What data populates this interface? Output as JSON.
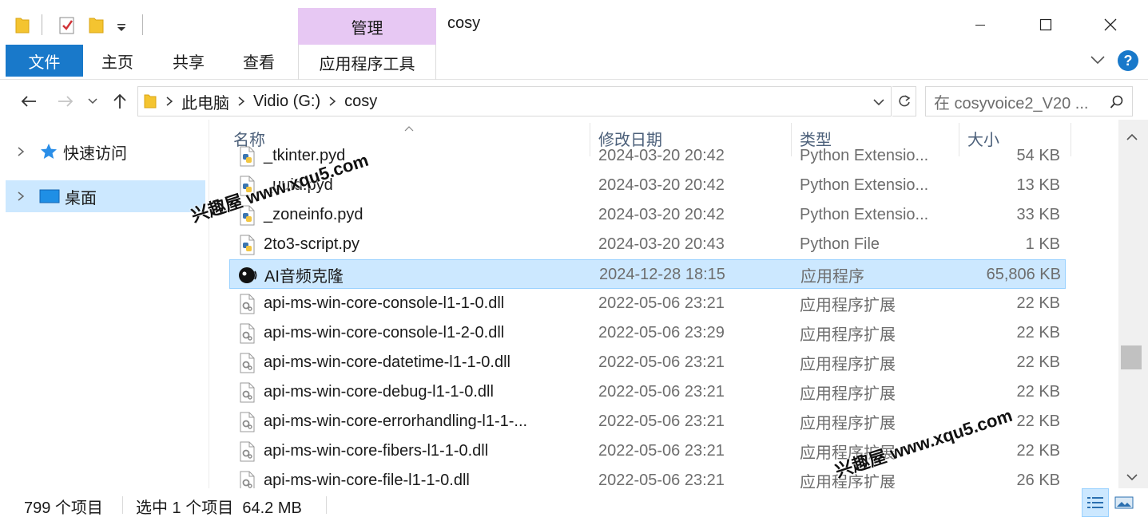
{
  "window": {
    "title": "cosy",
    "manage_tab": "管理",
    "min_icon": "minimize-icon",
    "max_icon": "maximize-icon",
    "close_icon": "close-icon"
  },
  "ribbon": {
    "file": "文件",
    "home": "主页",
    "share": "共享",
    "view": "查看",
    "app_tools": "应用程序工具",
    "help": "?"
  },
  "address": {
    "crumbs": [
      "此电脑",
      "Vidio (G:)",
      "cosy"
    ],
    "search_placeholder": "在 cosyvoice2_V20 ..."
  },
  "nav": {
    "items": [
      {
        "label": "快速访问",
        "icon": "star-icon",
        "selected": false
      },
      {
        "label": "桌面",
        "icon": "desktop-icon",
        "selected": true
      }
    ]
  },
  "columns": {
    "name": "名称",
    "date": "修改日期",
    "type": "类型",
    "size": "大小"
  },
  "files": [
    {
      "name": "_tkinter.pyd",
      "date": "2024-03-20 20:42",
      "type": "Python Extensio...",
      "size": "54 KB",
      "icon": "python-file-icon",
      "selected": false
    },
    {
      "name": "_uuid.pyd",
      "date": "2024-03-20 20:42",
      "type": "Python Extensio...",
      "size": "13 KB",
      "icon": "python-file-icon",
      "selected": false
    },
    {
      "name": "_zoneinfo.pyd",
      "date": "2024-03-20 20:42",
      "type": "Python Extensio...",
      "size": "33 KB",
      "icon": "python-file-icon",
      "selected": false
    },
    {
      "name": "2to3-script.py",
      "date": "2024-03-20 20:43",
      "type": "Python File",
      "size": "1 KB",
      "icon": "python-file-icon",
      "selected": false
    },
    {
      "name": "AI音频克隆",
      "date": "2024-12-28 18:15",
      "type": "应用程序",
      "size": "65,806 KB",
      "icon": "app-audio-icon",
      "selected": true
    },
    {
      "name": "api-ms-win-core-console-l1-1-0.dll",
      "date": "2022-05-06 23:21",
      "type": "应用程序扩展",
      "size": "22 KB",
      "icon": "dll-file-icon",
      "selected": false
    },
    {
      "name": "api-ms-win-core-console-l1-2-0.dll",
      "date": "2022-05-06 23:29",
      "type": "应用程序扩展",
      "size": "22 KB",
      "icon": "dll-file-icon",
      "selected": false
    },
    {
      "name": "api-ms-win-core-datetime-l1-1-0.dll",
      "date": "2022-05-06 23:21",
      "type": "应用程序扩展",
      "size": "22 KB",
      "icon": "dll-file-icon",
      "selected": false
    },
    {
      "name": "api-ms-win-core-debug-l1-1-0.dll",
      "date": "2022-05-06 23:21",
      "type": "应用程序扩展",
      "size": "22 KB",
      "icon": "dll-file-icon",
      "selected": false
    },
    {
      "name": "api-ms-win-core-errorhandling-l1-1-...",
      "date": "2022-05-06 23:21",
      "type": "应用程序扩展",
      "size": "22 KB",
      "icon": "dll-file-icon",
      "selected": false
    },
    {
      "name": "api-ms-win-core-fibers-l1-1-0.dll",
      "date": "2022-05-06 23:21",
      "type": "应用程序扩展",
      "size": "22 KB",
      "icon": "dll-file-icon",
      "selected": false
    },
    {
      "name": "api-ms-win-core-file-l1-1-0.dll",
      "date": "2022-05-06 23:21",
      "type": "应用程序扩展",
      "size": "26 KB",
      "icon": "dll-file-icon",
      "selected": false
    }
  ],
  "status": {
    "count": "799 个项目",
    "selection": "选中 1 个项目  64.2 MB"
  },
  "watermark": {
    "text": "兴趣屋 www.xqu5.com"
  }
}
